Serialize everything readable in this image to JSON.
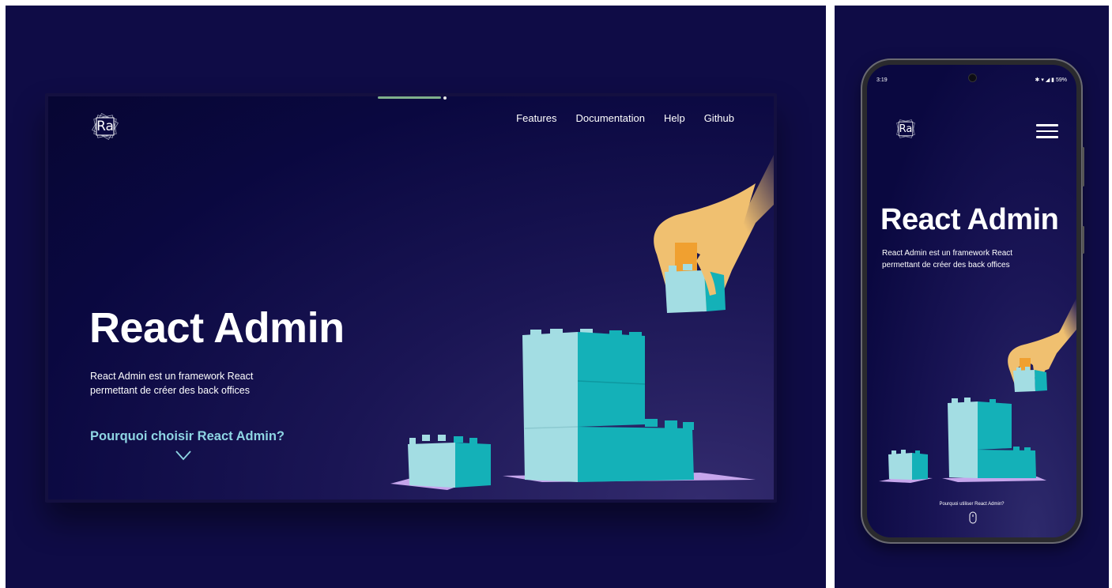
{
  "desktop": {
    "logo_text": "Ra",
    "nav": [
      "Features",
      "Documentation",
      "Help",
      "Github"
    ],
    "title": "React Admin",
    "subtitle_line1": "React Admin est un framework React",
    "subtitle_line2": "permettant de créer des back offices",
    "cta": "Pourquoi choisir React Admin?"
  },
  "mobile": {
    "status_time": "3:19",
    "status_battery": "59%",
    "logo_text": "Ra",
    "title": "React Admin",
    "subtitle_line1": "React Admin est un framework React",
    "subtitle_line2": "permettant de créer des back offices",
    "cta": "Pourquoi utiliser React Admin?"
  },
  "colors": {
    "background": "#0f0c46",
    "accent_cyan": "#8ed5e3",
    "block_light": "#a3dde3",
    "block_dark": "#14b1b8",
    "hand": "#f0c070",
    "shadow_purple": "#c6a6ec"
  },
  "icons": [
    "ra-logo",
    "chevron-down-icon",
    "hamburger-menu-icon",
    "mouse-scroll-icon",
    "bluetooth-icon",
    "wifi-icon",
    "signal-icon",
    "battery-icon"
  ]
}
